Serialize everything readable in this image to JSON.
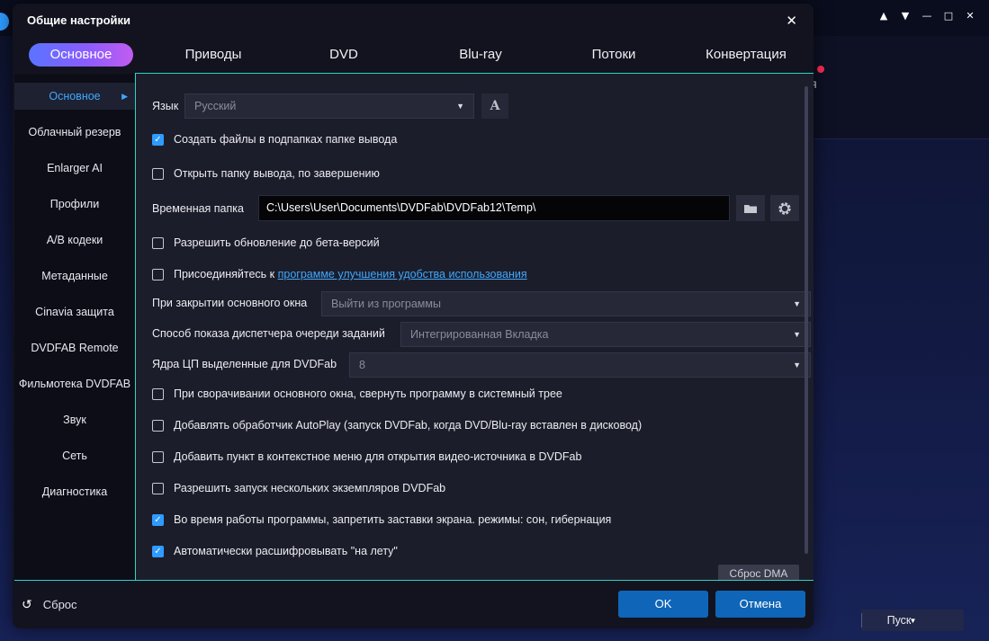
{
  "dialog": {
    "title": "Общие настройки",
    "close_icon": "close-icon"
  },
  "tabs": [
    {
      "label": "Основное",
      "active": true
    },
    {
      "label": "Приводы"
    },
    {
      "label": "DVD"
    },
    {
      "label": "Blu-ray"
    },
    {
      "label": "Потоки"
    },
    {
      "label": "Конвертация"
    }
  ],
  "sidebar": {
    "items": [
      {
        "label": "Основное",
        "active": true
      },
      {
        "label": "Облачный резерв"
      },
      {
        "label": "Enlarger AI"
      },
      {
        "label": "Профили"
      },
      {
        "label": "A/B кодеки"
      },
      {
        "label": "Метаданные"
      },
      {
        "label": "Cinavia защита"
      },
      {
        "label": "DVDFAB Remote"
      },
      {
        "label": "Фильмотека DVDFAB"
      },
      {
        "label": "Звук"
      },
      {
        "label": "Сеть"
      },
      {
        "label": "Диагностика"
      }
    ]
  },
  "settings": {
    "language_label": "Язык",
    "language_value": "Русский",
    "font_button": "A",
    "create_subfolders": "Создать файлы в подпапках папке вывода",
    "open_output": "Открыть папку вывода, по завершению",
    "temp_folder_label": "Временная папка",
    "temp_folder_value": "C:\\Users\\User\\Documents\\DVDFab\\DVDFab12\\Temp\\",
    "beta_updates": "Разрешить обновление до бета-версий",
    "join_prefix": "Присоединяйтесь к",
    "join_link": "программе улучшения удобства использования",
    "on_close_label": "При закрытии основного окна",
    "on_close_value": "Выйти из программы",
    "queue_label": "Способ показа диспетчера очереди заданий",
    "queue_value": "Интегрированная Вкладка",
    "cpu_label": "Ядра ЦП выделенные для DVDFab",
    "cpu_value": "8",
    "minimize_tray": "При сворачивании основного окна, свернуть программу в системный трее",
    "autoplay": "Добавлять обработчик AutoPlay (запуск DVDFab, когда DVD/Blu-ray вставлен в дисковод)",
    "context_menu": "Добавить пункт в контекстное меню для открытия видео-источника в DVDFab",
    "multi_instance": "Разрешить запуск нескольких экземпляров DVDFab",
    "prevent_sleep": "Во время работы программы, запретить заставки экрана. режимы: сон, гибернация",
    "auto_decrypt": "Автоматически расшифровывать \"на лету\"",
    "reset_dma": "Сброс DMA"
  },
  "checks": {
    "create_subfolders": true,
    "open_output": false,
    "beta_updates": false,
    "join": false,
    "minimize_tray": false,
    "autoplay": false,
    "context_menu": false,
    "multi_instance": false,
    "prevent_sleep": true,
    "auto_decrypt": true
  },
  "footer": {
    "reset_label": "Сброс",
    "ok_label": "OK",
    "cancel_label": "Отмена"
  },
  "background": {
    "text": "я",
    "start_label": "Пуск"
  },
  "colors": {
    "accent": "#2e9bff",
    "teal_line": "#2bd3c8",
    "button_blue": "#0f65b8"
  }
}
